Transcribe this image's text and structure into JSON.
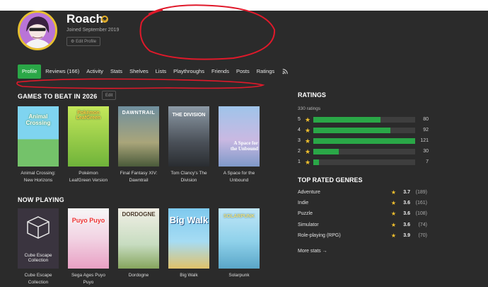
{
  "profile": {
    "username": "Roach",
    "joined": "Joined September 2019",
    "edit_profile": "Edit Profile"
  },
  "nav": {
    "items": [
      "Profile",
      "Reviews (166)",
      "Activity",
      "Stats",
      "Shelves",
      "Lists",
      "Playthroughs",
      "Friends",
      "Posts",
      "Ratings"
    ],
    "active": "Profile"
  },
  "games_to_beat": {
    "title": "GAMES TO BEAT IN 2026",
    "edit_label": "Edit",
    "games": [
      {
        "caption": "Animal Crossing: New Horizons",
        "cover_text": "Animal Crossing"
      },
      {
        "caption": "Pokémon LeafGreen Version",
        "cover_text": "Pokémon LeafGreen"
      },
      {
        "caption": "Final Fantasy XIV: Dawntrail",
        "cover_text": "DAWNTRAIL"
      },
      {
        "caption": "Tom Clancy's The Division",
        "cover_text": "THE DIVISION"
      },
      {
        "caption": "A Space for the Unbound",
        "cover_text": "A Space for the Unbound"
      }
    ]
  },
  "now_playing": {
    "title": "NOW PLAYING",
    "games": [
      {
        "caption": "Cube Escape Collection",
        "cover_text": "Cube Escape Collection"
      },
      {
        "caption": "Sega Ages Puyo Puyo",
        "cover_text": "Puyo Puyo"
      },
      {
        "caption": "Dordogne",
        "cover_text": "DORDOGNE"
      },
      {
        "caption": "Big Walk",
        "cover_text": "Big Walk"
      },
      {
        "caption": "Solarpunk",
        "cover_text": "SOLARPUNK"
      }
    ]
  },
  "ratings": {
    "title": "RATINGS",
    "total": "330 ratings",
    "rows": [
      {
        "stars": "5",
        "count": 80
      },
      {
        "stars": "4",
        "count": 92
      },
      {
        "stars": "3",
        "count": 121
      },
      {
        "stars": "2",
        "count": 30
      },
      {
        "stars": "1",
        "count": 7
      }
    ],
    "max_count": 121
  },
  "top_genres": {
    "title": "TOP RATED GENRES",
    "items": [
      {
        "name": "Adventure",
        "avg": "3.7",
        "count": "(189)"
      },
      {
        "name": "Indie",
        "avg": "3.6",
        "count": "(161)"
      },
      {
        "name": "Puzzle",
        "avg": "3.6",
        "count": "(108)"
      },
      {
        "name": "Simulator",
        "avg": "3.6",
        "count": "(74)"
      },
      {
        "name": "Role-playing (RPG)",
        "avg": "3.9",
        "count": "(70)"
      }
    ],
    "more_link": "More stats →"
  },
  "colors": {
    "accent_green": "#2aa747",
    "star_gold": "#f2c12e",
    "annotation_red": "#e0192a",
    "background": "#2b2b2b"
  }
}
